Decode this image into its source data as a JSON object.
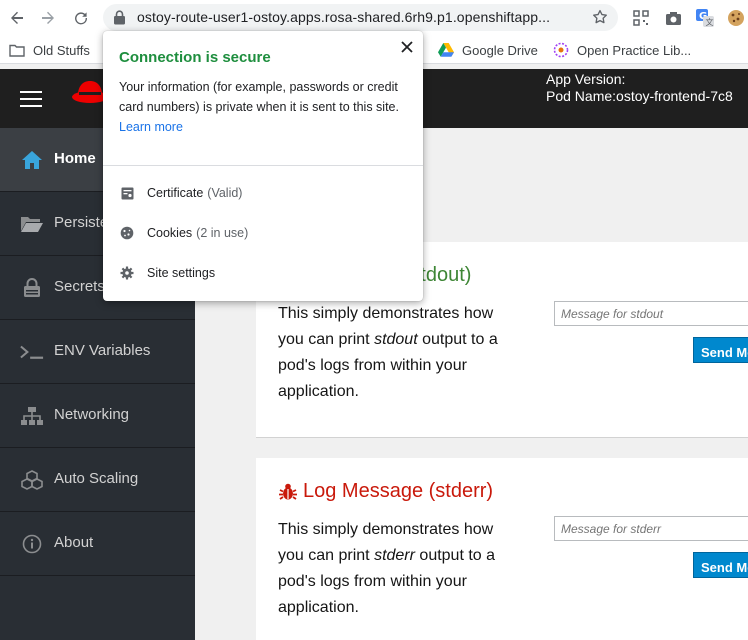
{
  "browser": {
    "url": "ostoy-route-user1-ostoy.apps.rosa-shared.6rh9.p1.openshiftapp...",
    "bookmarks": [
      {
        "label": "Old Stuffs",
        "icon": "folder-icon"
      },
      {
        "label": "Google Drive",
        "icon": "google-drive-icon"
      },
      {
        "label": "Open Practice Lib...",
        "icon": "open-practice-icon"
      }
    ]
  },
  "header": {
    "app_version_label": "App Version:",
    "pod_name_label": "Pod Name:ostoy-frontend-7c8"
  },
  "sidebar": {
    "items": [
      {
        "label": "Home",
        "icon": "home-icon",
        "active": true
      },
      {
        "label": "Persistent Storage",
        "icon": "folder-open-icon"
      },
      {
        "label": "Secrets",
        "icon": "lock-icon"
      },
      {
        "label": "ENV Variables",
        "icon": "terminal-icon"
      },
      {
        "label": "Networking",
        "icon": "network-icon"
      },
      {
        "label": "Auto Scaling",
        "icon": "cubes-icon"
      },
      {
        "label": "About",
        "icon": "info-icon"
      }
    ]
  },
  "main": {
    "stdout_card": {
      "title": "Log Message (stdout)",
      "desc_pre": "This simply demonstrates how you can print ",
      "desc_em": "stdout",
      "desc_post": " output to a pod's logs from within your application.",
      "placeholder": "Message for stdout",
      "button": "Send Message"
    },
    "stderr_card": {
      "title": "Log Message (stderr)",
      "desc_pre": "This simply demonstrates how you can print ",
      "desc_em": "stderr",
      "desc_post": " output to a pod's logs from within your application.",
      "placeholder": "Message for stderr",
      "button": "Send Message"
    }
  },
  "popup": {
    "title": "Connection is secure",
    "text": "Your information (for example, passwords or credit card numbers) is private when it is sent to this site.",
    "learn_more": "Learn more",
    "rows": [
      {
        "label": "Certificate",
        "sub": "(Valid)",
        "icon": "certificate-icon"
      },
      {
        "label": "Cookies",
        "sub": "(2 in use)",
        "icon": "cookie-icon"
      },
      {
        "label": "Site settings",
        "sub": "",
        "icon": "gear-icon"
      }
    ]
  },
  "colors": {
    "secure_green": "#1e8e3e",
    "link_blue": "#1a73e8",
    "stdout_title": "#3e8635",
    "stderr_title": "#c9190b",
    "button_blue": "#0088ce",
    "sidebar_bg": "#292e34",
    "header_bg": "#1f1f1f"
  }
}
